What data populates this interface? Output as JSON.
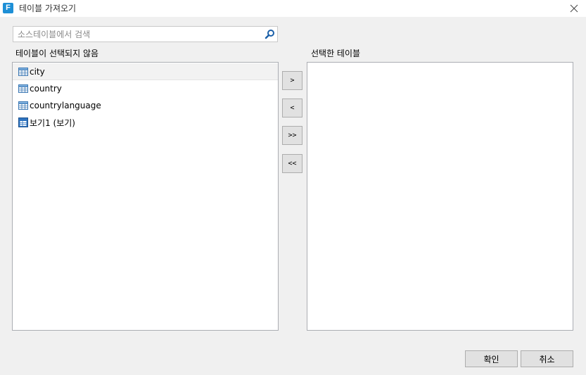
{
  "window": {
    "title": "테이블 가져오기",
    "app_icon_letter": "F"
  },
  "search": {
    "placeholder": "소스테이블에서 검색"
  },
  "left_panel": {
    "label": "테이블이 선택되지 않음",
    "items": [
      {
        "label": "city",
        "icon": "table-icon",
        "selected": true
      },
      {
        "label": "country",
        "icon": "table-icon"
      },
      {
        "label": "countrylanguage",
        "icon": "table-icon"
      },
      {
        "label": "보기1 (보기)",
        "icon": "view-icon"
      }
    ]
  },
  "right_panel": {
    "label": "선택한 테이블",
    "items": []
  },
  "transfer_buttons": {
    "move_right": ">",
    "move_left": "<",
    "move_all_right": ">>",
    "move_all_left": "<<"
  },
  "footer": {
    "ok_label": "확인",
    "cancel_label": "취소"
  },
  "colors": {
    "accent": "#1e8fd6",
    "background": "#f0f0f0",
    "selected_row": "#f2f2f2"
  }
}
